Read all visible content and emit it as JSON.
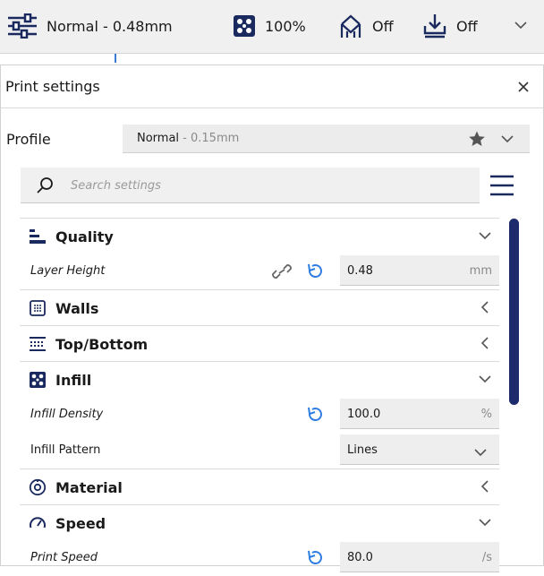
{
  "topbar": {
    "profile_label": "Normal - 0.48mm",
    "infill_value": "100%",
    "support_value": "Off",
    "adhesion_value": "Off"
  },
  "panel": {
    "title": "Print settings",
    "profile_label": "Profile",
    "profile_name": "Normal",
    "profile_sub": " - 0.15mm",
    "search_placeholder": "Search settings"
  },
  "categories": {
    "quality": "Quality",
    "walls": "Walls",
    "topbottom": "Top/Bottom",
    "infill": "Infill",
    "material": "Material",
    "speed": "Speed"
  },
  "settings": {
    "layer_height": {
      "label": "Layer Height",
      "value": "0.48",
      "unit": "mm"
    },
    "infill_density": {
      "label": "Infill Density",
      "value": "100.0",
      "unit": "%"
    },
    "infill_pattern": {
      "label": "Infill Pattern",
      "value": "Lines"
    },
    "print_speed": {
      "label": "Print Speed",
      "value": "80.0",
      "unit": "/s"
    }
  },
  "colors": {
    "accent": "#2f7de1",
    "scrollbar": "#1d2a6b"
  }
}
